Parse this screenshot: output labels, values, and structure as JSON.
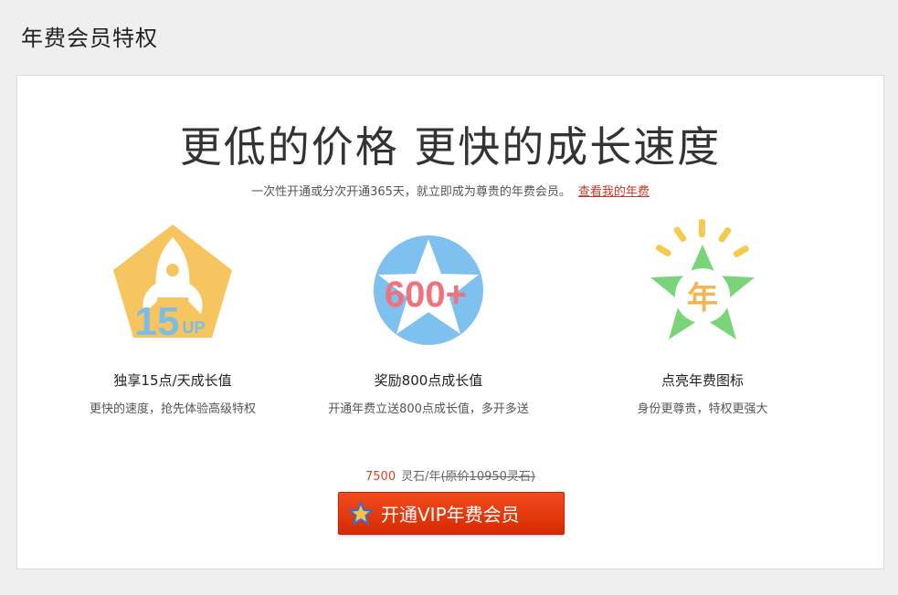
{
  "page": {
    "title": "年费会员特权"
  },
  "hero": {
    "headline": "更低的价格  更快的成长速度",
    "subline": "一次性开通或分次开通365天，就立即成为尊贵的年费会员。",
    "link": "查看我的年费"
  },
  "features": [
    {
      "icon": "rocket-pentagon-icon",
      "badge_num": "15",
      "badge_suffix": "UP",
      "title": "独享15点/天成长值",
      "desc": "更快的速度，抢先体验高级特权"
    },
    {
      "icon": "star-circle-icon",
      "badge": "600+",
      "title": "奖励800点成长值",
      "desc": "开通年费立送800点成长值，多开多送"
    },
    {
      "icon": "glowing-star-icon",
      "badge": "年",
      "title": "点亮年费图标",
      "desc": "身份更尊贵，特权更强大"
    }
  ],
  "pricing": {
    "amount": "7500",
    "unit": "灵石/年",
    "original": "(原价10950灵石)"
  },
  "cta": {
    "label": "开通VIP年费会员"
  },
  "colors": {
    "accent": "#d9452b",
    "button": "#e8380c",
    "pentagon": "#f7c55f",
    "badge_blue": "#7cbde8",
    "circle_blue": "#7ec0ee",
    "badge_red": "#f0727a",
    "star_green": "#7bd37a",
    "ray_yellow": "#f6c94f"
  }
}
